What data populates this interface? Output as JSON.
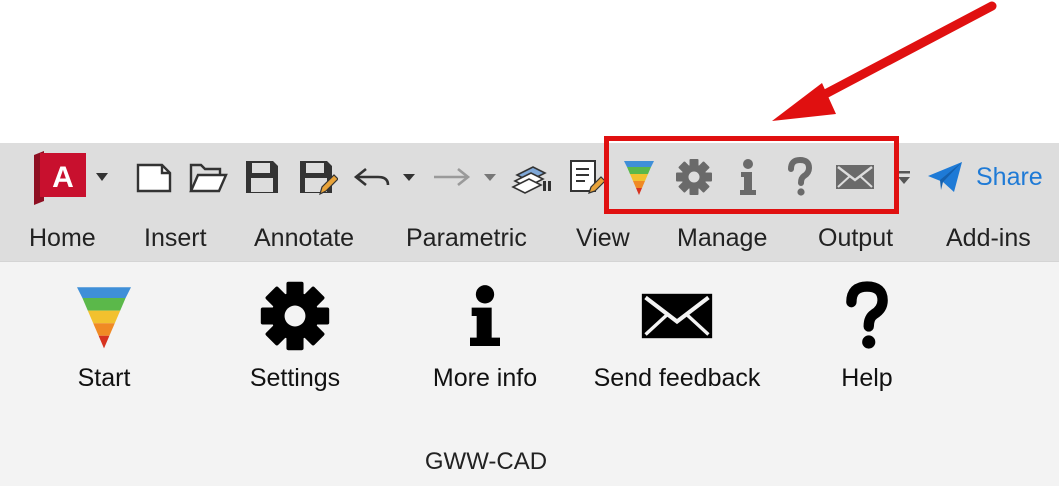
{
  "quick_access": {
    "app_logo_letter": "A",
    "share_label": "Share",
    "icons": [
      "app-menu",
      "new-file",
      "open-folder",
      "save",
      "save-as",
      "undo",
      "redo",
      "workspace-plot",
      "batch-plot",
      "gww-cad-start",
      "settings",
      "info",
      "help",
      "feedback-mail",
      "customize-overflow",
      "share"
    ]
  },
  "tabs": [
    "Home",
    "Insert",
    "Annotate",
    "Parametric",
    "View",
    "Manage",
    "Output",
    "Add-ins"
  ],
  "ribbon": {
    "buttons": [
      {
        "label": "Start",
        "icon": "gww-cad-funnel-icon"
      },
      {
        "label": "Settings",
        "icon": "gear-icon"
      },
      {
        "label": "More info",
        "icon": "info-icon"
      },
      {
        "label": "Send feedback",
        "icon": "envelope-icon"
      },
      {
        "label": "Help",
        "icon": "question-mark-icon"
      }
    ],
    "group_label": "GWW-CAD"
  },
  "colors": {
    "toolbar_bg": "#dddddd",
    "panel_bg": "#f3f3f3",
    "highlight": "#e01010",
    "share_blue": "#1e7ad6",
    "app_logo_red": "#c8102e"
  }
}
